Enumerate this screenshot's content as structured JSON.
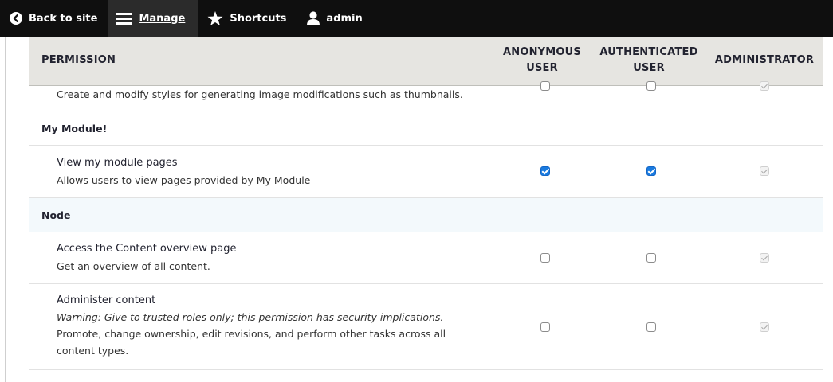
{
  "toolbar": {
    "back_label": "Back to site",
    "manage_label": "Manage",
    "shortcuts_label": "Shortcuts",
    "user_label": "admin"
  },
  "table": {
    "columns": {
      "permission": "PERMISSION",
      "anonymous_line1": "ANONYMOUS",
      "anonymous_line2": "USER",
      "authenticated_line1": "AUTHENTICATED",
      "authenticated_line2": "USER",
      "administrator": "ADMINISTRATOR"
    },
    "rows": [
      {
        "kind": "permission",
        "description": "Create and modify styles for generating image modifications such as thumbnails.",
        "anonymous": false,
        "authenticated": false,
        "administrator": true
      },
      {
        "kind": "module",
        "title": "My Module!"
      },
      {
        "kind": "permission",
        "title": "View my module pages",
        "description": "Allows users to view pages provided by My Module",
        "anonymous": true,
        "authenticated": true,
        "administrator": true
      },
      {
        "kind": "module",
        "title": "Node"
      },
      {
        "kind": "permission",
        "title": "Access the Content overview page",
        "description": "Get an overview of all content.",
        "anonymous": false,
        "authenticated": false,
        "administrator": true
      },
      {
        "kind": "permission",
        "title": "Administer content",
        "warning": "Warning: Give to trusted roles only; this permission has security implications.",
        "description_line1": "Promote, change ownership, edit revisions, and perform other tasks across all",
        "description_line2": "content types.",
        "anonymous": false,
        "authenticated": false,
        "administrator": true
      }
    ]
  }
}
